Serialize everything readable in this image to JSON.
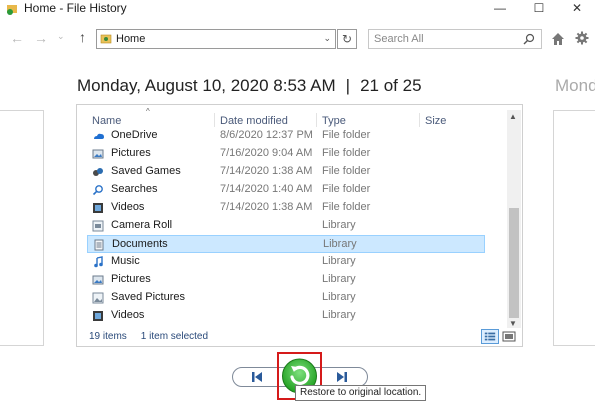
{
  "window": {
    "title": "Home - File History",
    "minimize": "—",
    "maximize": "☐",
    "close": "✕"
  },
  "nav": {
    "back": "←",
    "forward": "→",
    "recent": "⌄",
    "up": "↑",
    "address": "Home",
    "address_drop": "⌄",
    "refresh": "↻",
    "search_placeholder": "Search All"
  },
  "snapshot": {
    "date": "Monday, August 10, 2020 8:53 AM",
    "separator": "|",
    "position": "21 of 25",
    "next_date": "Mond"
  },
  "columns": {
    "sort_indicator": "^",
    "name": "Name",
    "date_modified": "Date modified",
    "type": "Type",
    "size": "Size"
  },
  "rows": [
    {
      "icon": "onedrive-icon",
      "name": "OneDrive",
      "date": "8/6/2020 12:37 PM",
      "type": "File folder",
      "selected": false
    },
    {
      "icon": "pictures-folder-icon",
      "name": "Pictures",
      "date": "7/16/2020 9:04 AM",
      "type": "File folder",
      "selected": false
    },
    {
      "icon": "saved-games-icon",
      "name": "Saved Games",
      "date": "7/14/2020 1:38 AM",
      "type": "File folder",
      "selected": false
    },
    {
      "icon": "searches-icon",
      "name": "Searches",
      "date": "7/14/2020 1:40 AM",
      "type": "File folder",
      "selected": false
    },
    {
      "icon": "videos-folder-icon",
      "name": "Videos",
      "date": "7/14/2020 1:38 AM",
      "type": "File folder",
      "selected": false
    },
    {
      "icon": "camera-roll-library-icon",
      "name": "Camera Roll",
      "date": "",
      "type": "Library",
      "selected": false
    },
    {
      "icon": "documents-library-icon",
      "name": "Documents",
      "date": "",
      "type": "Library",
      "selected": true
    },
    {
      "icon": "music-library-icon",
      "name": "Music",
      "date": "",
      "type": "Library",
      "selected": false
    },
    {
      "icon": "pictures-library-icon",
      "name": "Pictures",
      "date": "",
      "type": "Library",
      "selected": false
    },
    {
      "icon": "saved-pictures-library-icon",
      "name": "Saved Pictures",
      "date": "",
      "type": "Library",
      "selected": false
    },
    {
      "icon": "videos-library-icon",
      "name": "Videos",
      "date": "",
      "type": "Library",
      "selected": false
    }
  ],
  "status": {
    "items": "19 items",
    "selected": "1 item selected"
  },
  "controls": {
    "tooltip": "Restore to original location."
  },
  "colors": {
    "selection_bg": "#cce8ff",
    "selection_border": "#99d1ff",
    "restore_green": "#2bb52b",
    "highlight_red": "#d51a1a"
  }
}
